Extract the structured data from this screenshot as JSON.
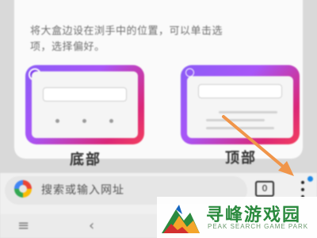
{
  "settings": {
    "description_lines": [
      "将大盒边设在浏手中的位置，可以单击选",
      "项，选择偏好。"
    ],
    "options": [
      {
        "label": "底部",
        "selected": true
      },
      {
        "label": "顶部",
        "selected": false
      }
    ]
  },
  "browser_toolbar": {
    "address_placeholder": "搜索或输入网址",
    "tab_count": "0",
    "logo_icon": "google-g-icon",
    "menu_icon": "more-vert-icon"
  },
  "annotation": {
    "arrow_color": "#f0954a"
  },
  "watermark": {
    "title": "寻峰游戏园",
    "subtitle": "PEAK SEARCH GAME PARK",
    "logo_icon": "mountain-logo"
  },
  "colors": {
    "accent": "#8b5cf6",
    "watermark_green": "#2b8a3e",
    "notification_dot": "#1e88e5"
  }
}
